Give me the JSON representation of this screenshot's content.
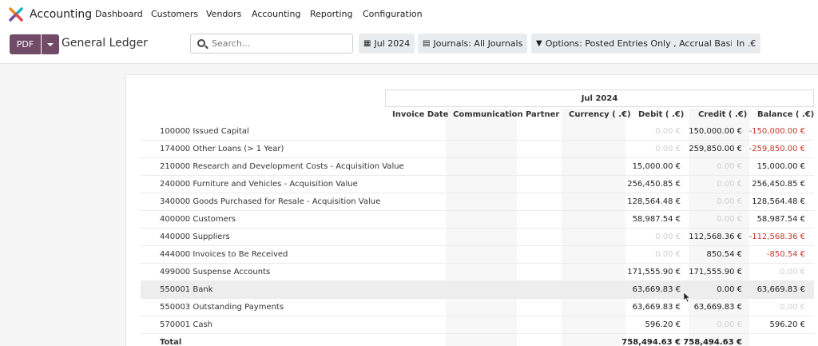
{
  "nav": {
    "app_title": "Accounting",
    "items": [
      "Dashboard",
      "Customers",
      "Vendors",
      "Accounting",
      "Reporting",
      "Configuration"
    ]
  },
  "control": {
    "pdf_label": "PDF",
    "page_title": "General Ledger",
    "search_placeholder": "Search...",
    "date_filter": "Jul 2024",
    "journals_filter": "Journals: All Journals",
    "options_filter": "Options: Posted Entries Only , Accrual Basis",
    "currency_filter": "In .€"
  },
  "report": {
    "period": "Jul 2024",
    "columns": {
      "invoice_date": "Invoice Date",
      "communication": "Communication",
      "partner": "Partner",
      "currency": "Currency ( .€)",
      "debit": "Debit ( .€)",
      "credit": "Credit ( .€)",
      "balance": "Balance ( .€)"
    },
    "rows": [
      {
        "account": "100000 Issued Capital",
        "debit": "0.00 €",
        "credit": "150,000.00 €",
        "balance": "-150,000.00 €"
      },
      {
        "account": "174000 Other Loans (> 1 Year)",
        "debit": "0.00 €",
        "credit": "259,850.00 €",
        "balance": "-259,850.00 €"
      },
      {
        "account": "210000 Research and Development Costs - Acquisition Value",
        "debit": "15,000.00 €",
        "credit": "0.00 €",
        "balance": "15,000.00 €"
      },
      {
        "account": "240000 Furniture and Vehicles - Acquisition Value",
        "debit": "256,450.85 €",
        "credit": "0.00 €",
        "balance": "256,450.85 €"
      },
      {
        "account": "340000 Goods Purchased for Resale - Acquisition Value",
        "debit": "128,564.48 €",
        "credit": "0.00 €",
        "balance": "128,564.48 €"
      },
      {
        "account": "400000 Customers",
        "debit": "58,987.54 €",
        "credit": "0.00 €",
        "balance": "58,987.54 €"
      },
      {
        "account": "440000 Suppliers",
        "debit": "0.00 €",
        "credit": "112,568.36 €",
        "balance": "-112,568.36 €"
      },
      {
        "account": "444000 Invoices to Be Received",
        "debit": "0.00 €",
        "credit": "850.54 €",
        "balance": "-850.54 €"
      },
      {
        "account": "499000 Suspense Accounts",
        "debit": "171,555.90 €",
        "credit": "171,555.90 €",
        "balance": "0.00 €"
      },
      {
        "account": "550001 Bank",
        "debit": "63,669.83 €",
        "credit": "0.00 €",
        "balance": "63,669.83 €"
      },
      {
        "account": "550003 Outstanding Payments",
        "debit": "63,669.83 €",
        "credit": "63,669.83 €",
        "balance": "0.00 €"
      },
      {
        "account": "570001 Cash",
        "debit": "596.20 €",
        "credit": "0.00 €",
        "balance": "596.20 €"
      }
    ],
    "total": {
      "label": "Total",
      "debit": "758,494.63 €",
      "credit": "758,494.63 €"
    }
  },
  "colors": {
    "brand": "#714b67",
    "negative": "#c0392b",
    "zero": "#cfcfcf"
  },
  "icons": [
    "odoo-accounting-logo",
    "search-icon",
    "calendar-icon",
    "book-icon",
    "filter-icon",
    "caret-down-icon"
  ]
}
